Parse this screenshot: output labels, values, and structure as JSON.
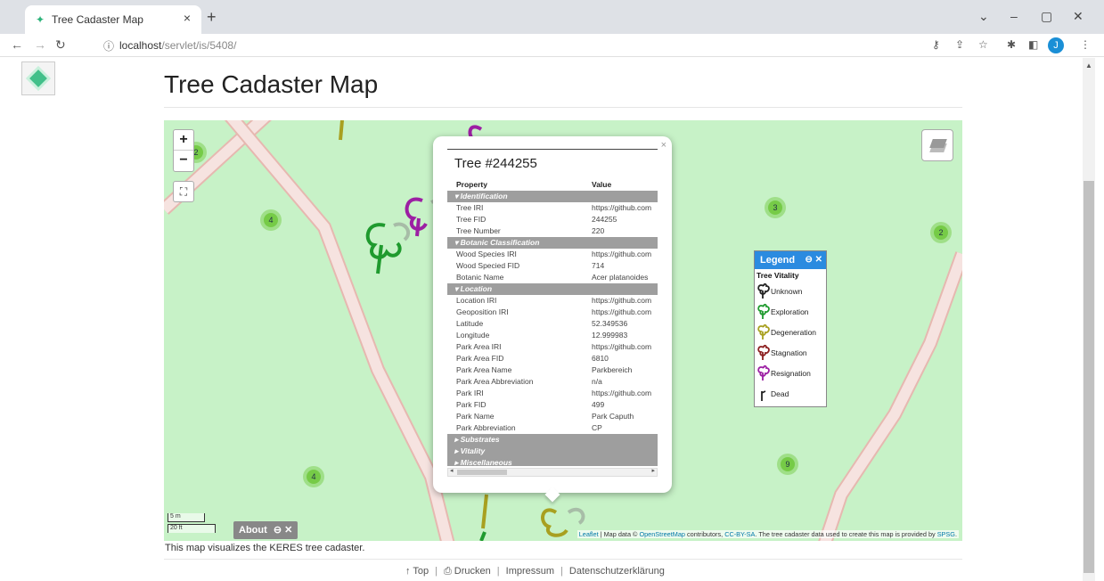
{
  "browser": {
    "tab_title": "Tree Cadaster Map",
    "tab_close": "×",
    "new_tab": "+",
    "url_host": "localhost",
    "url_path": "/servlet/is/5408/",
    "profile_initial": "J",
    "window_controls": [
      "⌄",
      "–",
      "▢",
      "✕"
    ]
  },
  "page": {
    "title": "Tree Cadaster Map",
    "caption": "This map visualizes the KERES tree cadaster.",
    "footer": {
      "top": "↑ Top",
      "print": "⎙ Drucken",
      "imprint": "Impressum",
      "privacy": "Datenschutzerklärung"
    }
  },
  "map": {
    "zoom_in": "+",
    "zoom_out": "−",
    "fullscreen": "⛶",
    "clusters": [
      "4",
      "3",
      "2",
      "4",
      "9",
      "2"
    ],
    "about_label": "About",
    "about_controls": "⊖ ✕",
    "scale_metric": "5 m",
    "scale_imperial": "20 ft",
    "attribution": {
      "leaflet": "Leaflet",
      "text1": " | Map data © ",
      "osm": "OpenStreetMap",
      "text2": " contributors, ",
      "license": "CC-BY-SA",
      "text3": ". The tree cadaster data used to create this map is provided by ",
      "provider": "SPSG",
      "text4": "."
    }
  },
  "popup": {
    "close": "×",
    "title": "Tree #244255",
    "header": {
      "property": "Property",
      "value": "Value"
    },
    "rows": [
      {
        "type": "section",
        "label": "▾ Identification"
      },
      {
        "type": "row",
        "k": "Tree IRI",
        "v": "https://github.com"
      },
      {
        "type": "row",
        "k": "Tree FID",
        "v": "244255"
      },
      {
        "type": "row",
        "k": "Tree Number",
        "v": "220"
      },
      {
        "type": "section",
        "label": "▾ Botanic Classification"
      },
      {
        "type": "row",
        "k": "Wood Species IRI",
        "v": "https://github.com"
      },
      {
        "type": "row",
        "k": "Wood Specied FID",
        "v": "714"
      },
      {
        "type": "row",
        "k": "Botanic Name",
        "v": "Acer platanoides"
      },
      {
        "type": "section",
        "label": "▾ Location"
      },
      {
        "type": "row",
        "k": "Location IRI",
        "v": "https://github.com"
      },
      {
        "type": "row",
        "k": "Geoposition IRI",
        "v": "https://github.com"
      },
      {
        "type": "row",
        "k": "Latitude",
        "v": "52.349536"
      },
      {
        "type": "row",
        "k": "Longitude",
        "v": "12.999983"
      },
      {
        "type": "row",
        "k": "Park Area IRI",
        "v": "https://github.com"
      },
      {
        "type": "row",
        "k": "Park Area FID",
        "v": "6810"
      },
      {
        "type": "row",
        "k": "Park Area Name",
        "v": "Parkbereich"
      },
      {
        "type": "row",
        "k": "Park Area Abbreviation",
        "v": "n/a"
      },
      {
        "type": "row",
        "k": "Park IRI",
        "v": "https://github.com"
      },
      {
        "type": "row",
        "k": "Park FID",
        "v": "499"
      },
      {
        "type": "row",
        "k": "Park Name",
        "v": "Park Caputh"
      },
      {
        "type": "row",
        "k": "Park Abbreviation",
        "v": "CP"
      },
      {
        "type": "section",
        "label": "▸ Substrates"
      },
      {
        "type": "section",
        "label": "▸ Vitality"
      },
      {
        "type": "section",
        "label": "▸ Miscellaneous"
      }
    ]
  },
  "legend": {
    "title": "Legend",
    "controls": "⊖ ✕",
    "subtitle": "Tree Vitality",
    "items": [
      {
        "label": "Unknown",
        "color": "#222222"
      },
      {
        "label": "Exploration",
        "color": "#1f9a2e"
      },
      {
        "label": "Degeneration",
        "color": "#a8a020"
      },
      {
        "label": "Stagnation",
        "color": "#8c1f1f"
      },
      {
        "label": "Resignation",
        "color": "#9c1fa3"
      },
      {
        "label": "Dead",
        "color": "#222222"
      }
    ]
  },
  "colors": {
    "map_bg": "#c7f2c7",
    "path_fill": "#f6e3e0",
    "path_edge": "#e6b8b0",
    "legend_header": "#2b8be0",
    "popup_section": "#9e9e9e"
  }
}
